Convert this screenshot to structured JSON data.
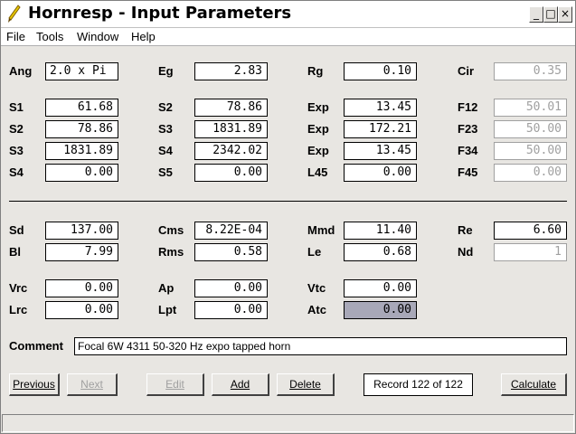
{
  "window": {
    "title": "Hornresp - Input Parameters"
  },
  "menu": [
    "File",
    "Tools",
    "Window",
    "Help"
  ],
  "params": {
    "Ang": "2.0 x Pi",
    "Eg": "2.83",
    "Rg": "0.10",
    "Cir": "0.35",
    "S1": "61.68",
    "S2a": "78.86",
    "Exp1": "13.45",
    "F12": "50.01",
    "S2": "78.86",
    "S3a": "1831.89",
    "Exp2": "172.21",
    "F23": "50.00",
    "S3": "1831.89",
    "S4a": "2342.02",
    "Exp3": "13.45",
    "F34": "50.00",
    "S4": "0.00",
    "S5": "0.00",
    "L45": "0.00",
    "F45": "0.00",
    "Sd": "137.00",
    "Cms": "8.22E-04",
    "Mmd": "11.40",
    "Re": "6.60",
    "Bl": "7.99",
    "Rms": "0.58",
    "Le": "0.68",
    "Nd": "1",
    "Vrc": "0.00",
    "Ap": "0.00",
    "Vtc": "0.00",
    "Lrc": "0.00",
    "Lpt": "0.00",
    "Atc": "0.00"
  },
  "labels": {
    "Ang": "Ang",
    "Eg": "Eg",
    "Rg": "Rg",
    "Cir": "Cir",
    "S1": "S1",
    "S2a": "S2",
    "Exp1": "Exp",
    "F12": "F12",
    "S2": "S2",
    "S3a": "S3",
    "Exp2": "Exp",
    "F23": "F23",
    "S3": "S3",
    "S4a": "S4",
    "Exp3": "Exp",
    "F34": "F34",
    "S4": "S4",
    "S5": "S5",
    "L45": "L45",
    "F45": "F45",
    "Sd": "Sd",
    "Cms": "Cms",
    "Mmd": "Mmd",
    "Re": "Re",
    "Bl": "Bl",
    "Rms": "Rms",
    "Le": "Le",
    "Nd": "Nd",
    "Vrc": "Vrc",
    "Ap": "Ap",
    "Vtc": "Vtc",
    "Lrc": "Lrc",
    "Lpt": "Lpt",
    "Atc": "Atc",
    "Comment": "Comment"
  },
  "comment": "Focal 6W 4311 50-320 Hz expo tapped horn",
  "buttons": {
    "previous": "Previous",
    "next": "Next",
    "edit": "Edit",
    "add": "Add",
    "delete": "Delete",
    "calculate": "Calculate"
  },
  "record": "Record 122 of 122",
  "icons": {
    "app": "pencil-icon",
    "minimize": "minimize-icon",
    "maximize": "maximize-icon",
    "close": "close-icon"
  }
}
